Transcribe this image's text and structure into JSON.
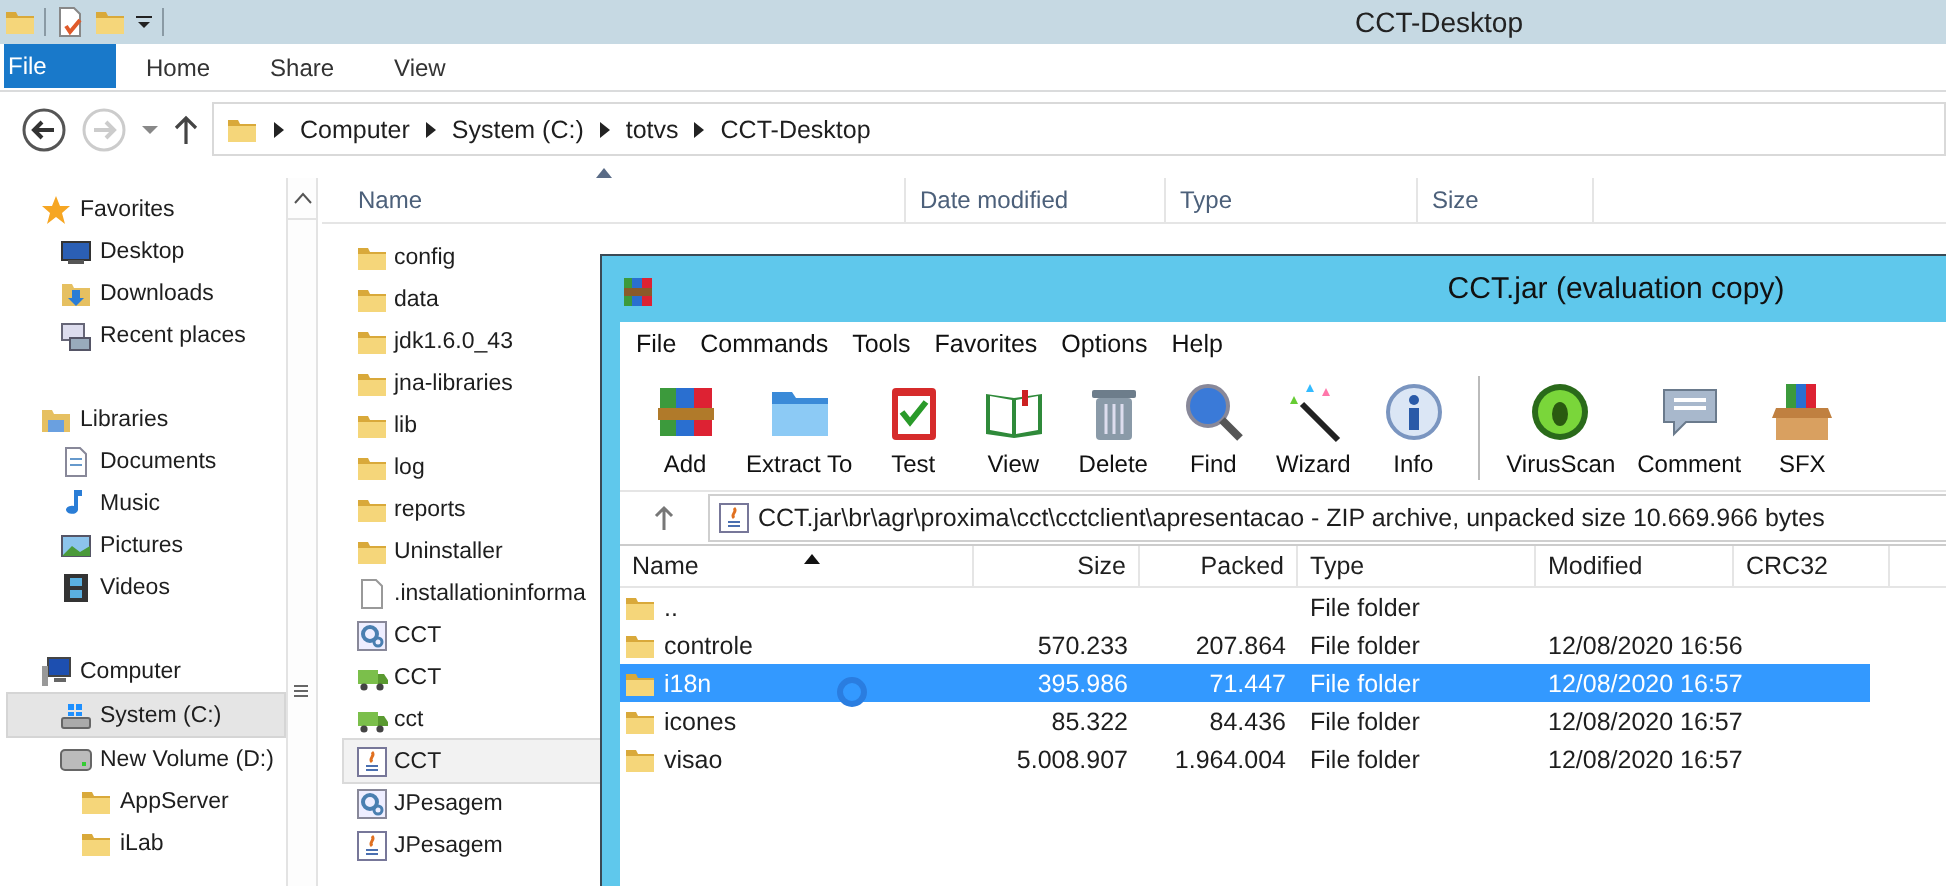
{
  "explorer": {
    "title": "CCT-Desktop",
    "ribbon_tabs": [
      {
        "label": "File",
        "kind": "menu"
      },
      {
        "label": "Home",
        "kind": "tab"
      },
      {
        "label": "Share",
        "kind": "tab"
      },
      {
        "label": "View",
        "kind": "tab"
      }
    ],
    "address": [
      "Computer",
      "System (C:)",
      "totvs",
      "CCT-Desktop"
    ],
    "nav": [
      {
        "label": "Favorites",
        "kind": "star",
        "selected": false,
        "children": [
          {
            "label": "Desktop",
            "kind": "desktop",
            "selected": false
          },
          {
            "label": "Downloads",
            "kind": "downloads",
            "selected": false
          },
          {
            "label": "Recent places",
            "kind": "recent",
            "selected": false
          }
        ]
      },
      {
        "label": "Libraries",
        "kind": "library",
        "selected": false,
        "children": [
          {
            "label": "Documents",
            "kind": "documents",
            "selected": false
          },
          {
            "label": "Music",
            "kind": "music",
            "selected": false
          },
          {
            "label": "Pictures",
            "kind": "pictures",
            "selected": false
          },
          {
            "label": "Videos",
            "kind": "videos",
            "selected": false
          }
        ]
      },
      {
        "label": "Computer",
        "kind": "computer",
        "selected": false,
        "children": [
          {
            "label": "System (C:)",
            "kind": "system-drive",
            "selected": true
          },
          {
            "label": "New Volume (D:)",
            "kind": "drive",
            "selected": false,
            "children": [
              {
                "label": "AppServer",
                "kind": "folder",
                "selected": false
              },
              {
                "label": "iLab",
                "kind": "folder",
                "selected": false
              }
            ]
          }
        ]
      }
    ],
    "columns": [
      "Name",
      "Date modified",
      "Type",
      "Size"
    ],
    "files": [
      {
        "name": "config",
        "kind": "folder",
        "selected": false
      },
      {
        "name": "data",
        "kind": "folder",
        "selected": false
      },
      {
        "name": "jdk1.6.0_43",
        "kind": "folder",
        "selected": false
      },
      {
        "name": "jna-libraries",
        "kind": "folder",
        "selected": false
      },
      {
        "name": "lib",
        "kind": "folder",
        "selected": false
      },
      {
        "name": "log",
        "kind": "folder",
        "selected": false
      },
      {
        "name": "reports",
        "kind": "folder",
        "selected": false
      },
      {
        "name": "Uninstaller",
        "kind": "folder",
        "selected": false
      },
      {
        "name": ".installationinforma",
        "kind": "file",
        "selected": false
      },
      {
        "name": "CCT",
        "kind": "gear",
        "selected": false
      },
      {
        "name": "CCT",
        "kind": "truck",
        "selected": false
      },
      {
        "name": "cct",
        "kind": "truck",
        "selected": false
      },
      {
        "name": "CCT",
        "kind": "java",
        "selected": true
      },
      {
        "name": "JPesagem",
        "kind": "gear",
        "selected": false
      },
      {
        "name": "JPesagem",
        "kind": "java",
        "selected": false
      }
    ]
  },
  "winrar": {
    "title": "CCT.jar (evaluation copy)",
    "menu": [
      "File",
      "Commands",
      "Tools",
      "Favorites",
      "Options",
      "Help"
    ],
    "toolbar_groups": [
      {
        "buttons": [
          {
            "label": "Add",
            "kind": "add"
          },
          {
            "label": "Extract To",
            "kind": "extract"
          },
          {
            "label": "Test",
            "kind": "test"
          },
          {
            "label": "View",
            "kind": "view"
          },
          {
            "label": "Delete",
            "kind": "delete"
          },
          {
            "label": "Find",
            "kind": "find"
          },
          {
            "label": "Wizard",
            "kind": "wizard"
          },
          {
            "label": "Info",
            "kind": "info"
          }
        ]
      },
      {
        "buttons": [
          {
            "label": "VirusScan",
            "kind": "virusscan"
          },
          {
            "label": "Comment",
            "kind": "comment"
          },
          {
            "label": "SFX",
            "kind": "sfx"
          }
        ]
      }
    ],
    "path": "CCT.jar\\br\\agr\\proxima\\cct\\cctclient\\apresentacao - ZIP archive, unpacked size 10.669.966 bytes",
    "columns": [
      "Name",
      "Size",
      "Packed",
      "Type",
      "Modified",
      "CRC32"
    ],
    "rows": [
      {
        "name": "..",
        "type": "File folder",
        "selected": false
      },
      {
        "name": "controle",
        "size": "570.233",
        "packed": "207.864",
        "type": "File folder",
        "modified": "12/08/2020 16:56",
        "selected": false
      },
      {
        "name": "i18n",
        "size": "395.986",
        "packed": "71.447",
        "type": "File folder",
        "modified": "12/08/2020 16:57",
        "selected": true
      },
      {
        "name": "icones",
        "size": "85.322",
        "packed": "84.436",
        "type": "File folder",
        "modified": "12/08/2020 16:57",
        "selected": false
      },
      {
        "name": "visao",
        "size": "5.008.907",
        "packed": "1.964.004",
        "type": "File folder",
        "modified": "12/08/2020 16:57",
        "selected": false
      }
    ]
  }
}
